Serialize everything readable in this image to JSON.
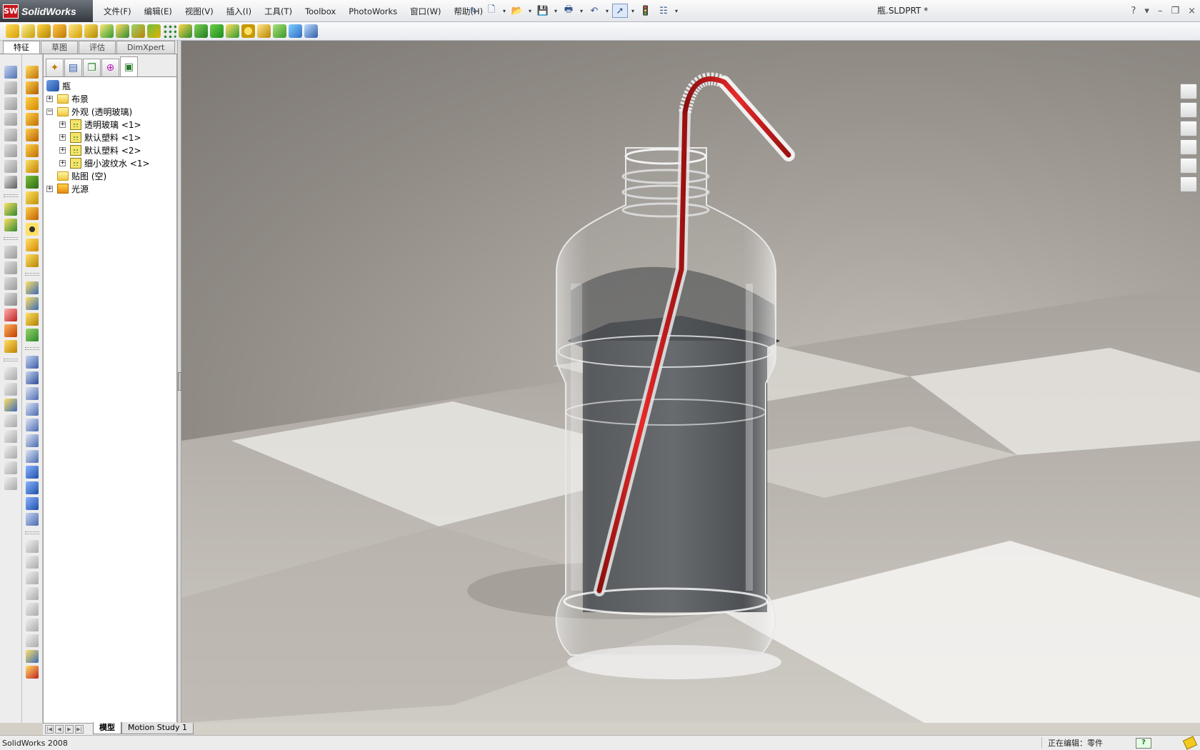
{
  "app": {
    "brand_badge": "SW",
    "name": "SolidWorks"
  },
  "menu": [
    "文件(F)",
    "编辑(E)",
    "视图(V)",
    "插入(I)",
    "工具(T)",
    "Toolbox",
    "PhotoWorks",
    "窗口(W)",
    "帮助(H)"
  ],
  "quick_access": [
    "pin-icon",
    "new-document-icon",
    "open-icon",
    "save-icon",
    "print-icon",
    "undo-icon",
    "select-icon",
    "rebuild-icon",
    "options-icon"
  ],
  "document_title": "瓶.SLDPRT *",
  "window_controls": {
    "help": "?",
    "minimize": "–",
    "restore": "❐",
    "close": "×"
  },
  "command_tabs": [
    "特征",
    "草图",
    "评估",
    "DimXpert"
  ],
  "active_command_tab": "特征",
  "feature_manager": {
    "tabs": [
      "featuremanager-tree-icon",
      "propertymanager-icon",
      "configurationmanager-icon",
      "dimxpertmanager-icon",
      "display-manager-icon"
    ],
    "active_tab": 4,
    "root": "瓶",
    "items": [
      {
        "label": "布景",
        "level": 1,
        "toggle": "+",
        "icon": "folder-icon"
      },
      {
        "label": "外观 (透明玻璃)",
        "level": 1,
        "toggle": "−",
        "icon": "folder-icon"
      },
      {
        "label": "透明玻璃 <1>",
        "level": 2,
        "toggle": "+",
        "icon": "appearance-icon"
      },
      {
        "label": "默认塑料 <1>",
        "level": 2,
        "toggle": "+",
        "icon": "appearance-icon"
      },
      {
        "label": "默认塑料 <2>",
        "level": 2,
        "toggle": "+",
        "icon": "appearance-icon"
      },
      {
        "label": "细小波纹水 <1>",
        "level": 2,
        "toggle": "+",
        "icon": "appearance-icon"
      },
      {
        "label": "贴图 (空)",
        "level": 1,
        "toggle": "",
        "icon": "folder-icon"
      },
      {
        "label": "光源",
        "level": 1,
        "toggle": "+",
        "icon": "lights-icon"
      }
    ]
  },
  "bottom_tabs": [
    "模型",
    "Motion Study 1"
  ],
  "active_bottom_tab": "模型",
  "status": {
    "product": "SolidWorks 2008",
    "editing": "正在编辑：零件",
    "help_badge": "?"
  },
  "task_pane": [
    "solidworks-resources-icon",
    "design-library-icon",
    "file-explorer-icon",
    "view-palette-icon",
    "appearances-icon",
    "custom-properties-icon"
  ],
  "colors": {
    "straw_stripe": "#d61a1a",
    "titlebar_brand": "#c4161c",
    "viewport_floor": "#bdb8b1"
  }
}
